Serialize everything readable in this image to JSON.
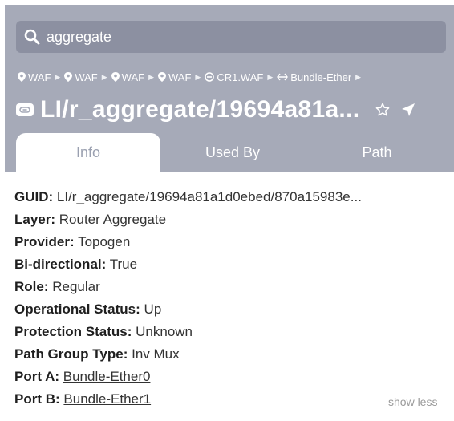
{
  "search": {
    "value": "aggregate"
  },
  "breadcrumbs": [
    {
      "icon": "location-pin-icon",
      "label": "WAF"
    },
    {
      "icon": "location-pin-icon",
      "label": "WAF"
    },
    {
      "icon": "location-pin-icon",
      "label": "WAF"
    },
    {
      "icon": "location-pin-icon",
      "label": "WAF"
    },
    {
      "icon": "router-icon",
      "label": "CR1.WAF"
    },
    {
      "icon": "bidirectional-arrow-icon",
      "label": "Bundle-Ether"
    }
  ],
  "title": {
    "icon": "link-icon",
    "text": "LI/r_aggregate/19694a81a..."
  },
  "tabs": [
    {
      "label": "Info",
      "active": true
    },
    {
      "label": "Used By",
      "active": false
    },
    {
      "label": "Path",
      "active": false
    }
  ],
  "details": [
    {
      "label": "GUID:",
      "value": "LI/r_aggregate/19694a81a1d0ebed/870a15983e..."
    },
    {
      "label": "Layer:",
      "value": "Router Aggregate"
    },
    {
      "label": "Provider:",
      "value": "Topogen"
    },
    {
      "label": "Bi-directional:",
      "value": "True"
    },
    {
      "label": "Role:",
      "value": "Regular"
    },
    {
      "label": "Operational Status:",
      "value": "Up"
    },
    {
      "label": "Protection Status:",
      "value": "Unknown"
    },
    {
      "label": "Path Group Type:",
      "value": "Inv Mux"
    },
    {
      "label": "Port A:",
      "value": "Bundle-Ether0",
      "link": true
    },
    {
      "label": "Port B:",
      "value": "Bundle-Ether1",
      "link": true
    }
  ],
  "show_less": "show less",
  "colors": {
    "header_bg": "#a6aab8",
    "search_bg": "#8c90a1",
    "active_tab_text": "#9aa0b0"
  }
}
